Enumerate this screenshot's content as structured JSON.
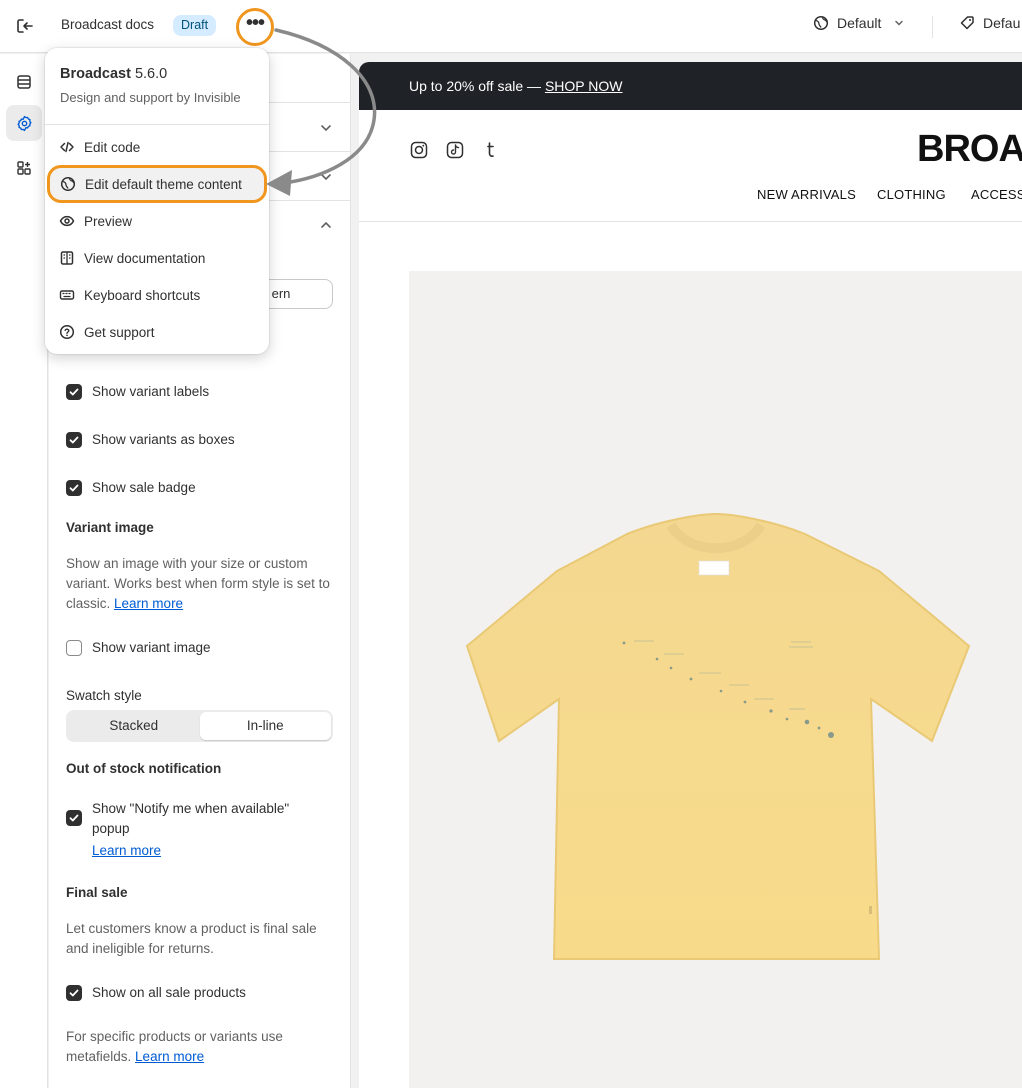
{
  "topbar": {
    "title": "Broadcast docs",
    "badge": "Draft",
    "more_label": "•••",
    "locale_label": "Default",
    "market_label": "Defau"
  },
  "panel": {
    "seg_button_partial": "ern",
    "checkboxes": [
      {
        "label": "Show variant labels",
        "checked": true
      },
      {
        "label": "Show variants as boxes",
        "checked": true
      },
      {
        "label": "Show sale badge",
        "checked": true
      }
    ],
    "variant_image": {
      "heading": "Variant image",
      "description": "Show an image with your size or custom variant. Works best when form style is set to classic.",
      "link": "Learn more",
      "checkbox_label": "Show variant image",
      "checked": false
    },
    "swatch": {
      "label": "Swatch style",
      "options": [
        "Stacked",
        "In-line"
      ],
      "selected": "In-line"
    },
    "out_of_stock": {
      "heading": "Out of stock notification",
      "checkbox_label": "Show \"Notify me when available\" popup",
      "checked": true,
      "link": "Learn more"
    },
    "final_sale": {
      "heading": "Final sale",
      "description": "Let customers know a product is final sale and ineligible for returns.",
      "checkbox_label": "Show on all sale products",
      "checked": true,
      "footer_text": "For specific products or variants use metafields.",
      "footer_link": "Learn more"
    }
  },
  "menu": {
    "theme_name": "Broadcast",
    "version": "5.6.0",
    "subtitle": "Design and support by Invisible",
    "items": [
      {
        "label": "Edit code",
        "icon": "code-icon"
      },
      {
        "label": "Edit default theme content",
        "icon": "globe-icon",
        "highlighted": true
      },
      {
        "label": "Preview",
        "icon": "eye-icon"
      },
      {
        "label": "View documentation",
        "icon": "book-icon"
      },
      {
        "label": "Keyboard shortcuts",
        "icon": "keyboard-icon"
      },
      {
        "label": "Get support",
        "icon": "question-icon"
      }
    ]
  },
  "preview": {
    "announcement": "Up to 20% off sale — ",
    "announcement_link": "SHOP NOW",
    "logo": "BROAD",
    "nav": [
      "NEW ARRIVALS",
      "CLOTHING",
      "ACCESSO"
    ]
  },
  "colors": {
    "highlight": "#f0961e",
    "announcement_bg": "#1f2227",
    "link": "#005bd3",
    "tshirt": "#f6d888"
  }
}
